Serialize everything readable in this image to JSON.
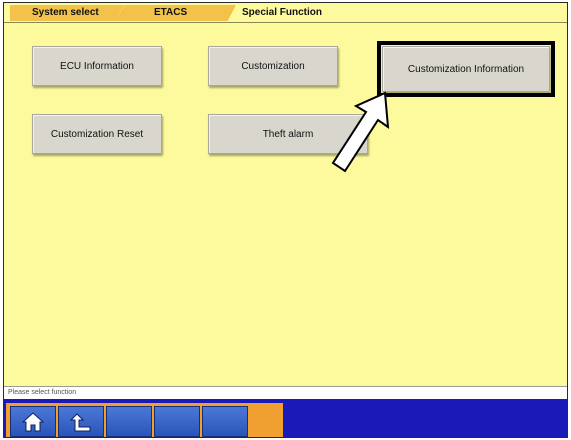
{
  "breadcrumb": {
    "items": [
      "System select",
      "ETACS",
      "Special Function"
    ]
  },
  "buttons": {
    "ecu_information": "ECU Information",
    "customization": "Customization",
    "customization_information": "Customization Information",
    "customization_reset": "Customization Reset",
    "theft_alarm": "Theft alarm"
  },
  "status": {
    "message": "Please select function"
  },
  "toolbar": {
    "icons": [
      "home-icon",
      "back-icon"
    ]
  },
  "colors": {
    "background": "#fdfa9e",
    "breadcrumb_tab": "#f2c24a",
    "toolbar": "#1a1ab8",
    "toolbar_buttons_panel": "#f0a030",
    "button_face": "#d9d7cd"
  }
}
